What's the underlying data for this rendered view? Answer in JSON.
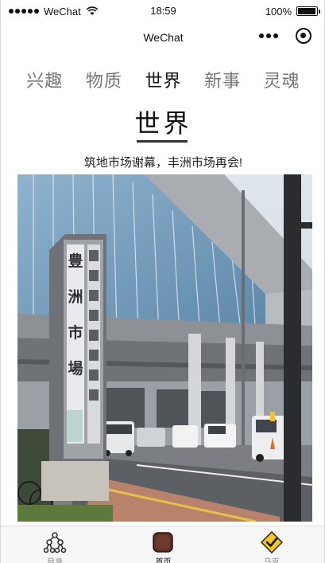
{
  "status_bar": {
    "carrier": "WeChat",
    "time": "18:59",
    "battery_percent": "100%",
    "battery_level": 1.0
  },
  "nav": {
    "title": "WeChat",
    "more_icon": "more-dots-icon",
    "close_icon": "record-close-icon"
  },
  "tabs": [
    {
      "label": "兴趣",
      "active": false
    },
    {
      "label": "物质",
      "active": false
    },
    {
      "label": "世界",
      "active": true
    },
    {
      "label": "新事",
      "active": false
    },
    {
      "label": "灵魂",
      "active": false
    }
  ],
  "article": {
    "heading": "世界",
    "subtitle": "筑地市场谢幕，丰洲市场再会!",
    "image_sign_text": "豊洲市場"
  },
  "bottom_nav": [
    {
      "label": "目录",
      "icon": "network-tree-icon",
      "active": false
    },
    {
      "label": "首页",
      "icon": "home-square-icon",
      "active": true
    },
    {
      "label": "马克",
      "icon": "check-diamond-icon",
      "active": false
    }
  ],
  "colors": {
    "active_text": "#111111",
    "inactive_text": "#777777",
    "sign_yellow": "#f5c518"
  }
}
